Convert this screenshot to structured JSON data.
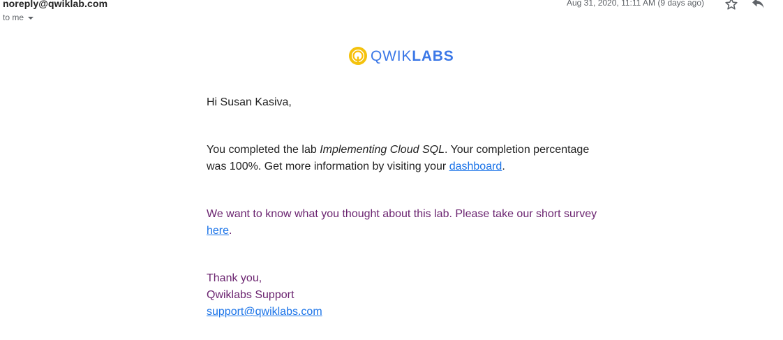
{
  "header": {
    "sender": "noreply@qwiklab.com",
    "recipient": "to me",
    "date": "Aug 31, 2020, 11:11 AM (9 days ago)",
    "icons": [
      "star-icon",
      "reply-icon"
    ]
  },
  "logo": {
    "light": "QWIK",
    "bold": "LABS",
    "colors": {
      "ring": "#f4c20d",
      "text": "#3b78e7"
    }
  },
  "email": {
    "greeting": "Hi Susan Kasiva,",
    "completion_pre": "You completed the lab ",
    "lab_name": "Implementing Cloud SQL",
    "completion_mid": ". Your completion percentage was 100%. Get more information by visiting your ",
    "dashboard_link": "dashboard",
    "completion_end": ".",
    "survey_pre": "We want to know what you thought about this lab. Please take our short survey ",
    "survey_link": "here",
    "survey_end": ".",
    "thanks": "Thank you,",
    "signature": "Qwiklabs Support",
    "support_email": "support@qwiklabs.com"
  },
  "colors": {
    "text": "#222222",
    "muted": "#5f6368",
    "purple": "#6b2470",
    "link": "#1a73e8"
  }
}
